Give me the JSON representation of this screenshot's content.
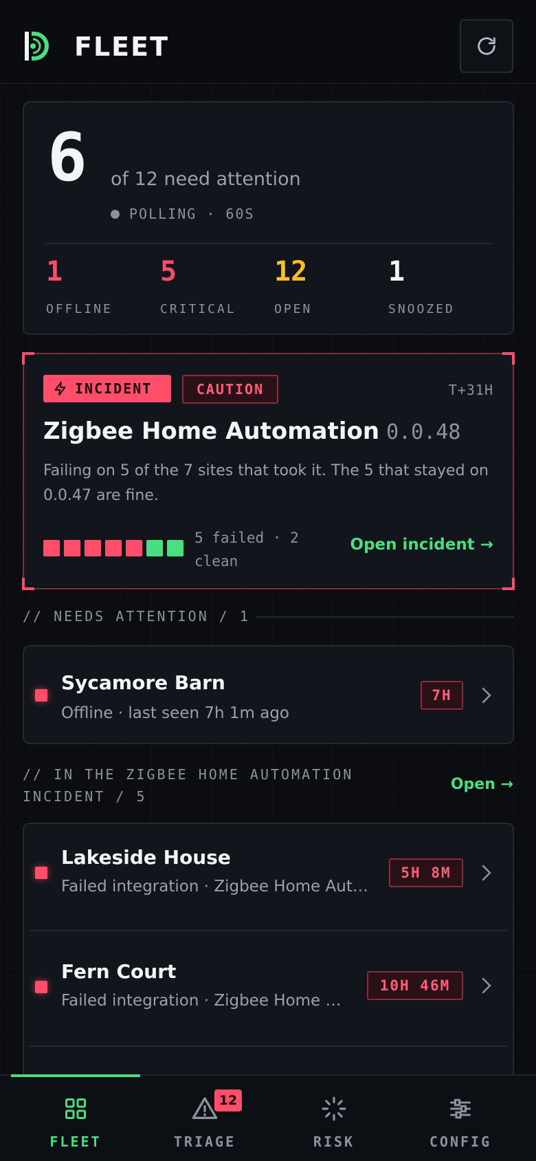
{
  "app": {
    "title": "FLEET"
  },
  "summary": {
    "count": "6",
    "attention_text": "of 12 need attention",
    "polling": "POLLING · 60S",
    "stats": [
      {
        "value": "1",
        "label": "OFFLINE",
        "color": "#ff4d6a"
      },
      {
        "value": "5",
        "label": "CRITICAL",
        "color": "#ff4d6a"
      },
      {
        "value": "12",
        "label": "OPEN",
        "color": "#fbbf24"
      },
      {
        "value": "1",
        "label": "SNOOZED",
        "color": "#f3f4f6"
      }
    ]
  },
  "incident": {
    "badge": "INCIDENT",
    "severity": "CAUTION",
    "elapsed": "T+31H",
    "title": "Zigbee Home Automation",
    "version": "0.0.48",
    "description": "Failing on 5 of the 7 sites that took it. The 5 that stayed on 0.0.47 are fine.",
    "sites": [
      "failed",
      "failed",
      "failed",
      "failed",
      "failed",
      "clean",
      "clean"
    ],
    "sites_text": "5 failed · 2 clean",
    "action": "Open incident →"
  },
  "needs_attention": {
    "header": "// NEEDS ATTENTION / 1",
    "items": [
      {
        "name": "Sycamore Barn",
        "sub": "Offline · last seen 7h 1m ago",
        "time": "7H"
      }
    ]
  },
  "incident_section": {
    "header": "// IN THE ZIGBEE HOME AUTOMATION INCIDENT / 5",
    "action": "Open →",
    "items": [
      {
        "name": "Lakeside House",
        "sub": "Failed integration · Zigbee Home Automation",
        "time": "5H 8M"
      },
      {
        "name": "Fern Court",
        "sub": "Failed integration · Zigbee Home Automation",
        "time": "10H 46M"
      }
    ]
  },
  "nav": {
    "items": [
      {
        "label": "FLEET",
        "icon": "grid-icon"
      },
      {
        "label": "TRIAGE",
        "icon": "warning-icon",
        "badge": "12"
      },
      {
        "label": "RISK",
        "icon": "loader-icon"
      },
      {
        "label": "CONFIG",
        "icon": "sliders-icon"
      }
    ],
    "accent": "#4ade80"
  }
}
